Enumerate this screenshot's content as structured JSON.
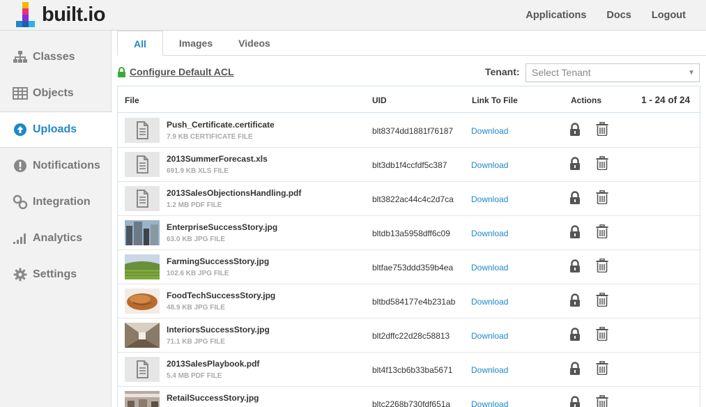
{
  "app": {
    "logo_text": "built.io"
  },
  "topnav": [
    "Applications",
    "Docs",
    "Logout"
  ],
  "sidebar": {
    "items": [
      {
        "label": "Classes",
        "icon": "sitemap-icon",
        "active": false
      },
      {
        "label": "Objects",
        "icon": "table-icon",
        "active": false
      },
      {
        "label": "Uploads",
        "icon": "upload-icon",
        "active": true
      },
      {
        "label": "Notifications",
        "icon": "alert-icon",
        "active": false
      },
      {
        "label": "Integration",
        "icon": "link-icon",
        "active": false
      },
      {
        "label": "Analytics",
        "icon": "bars-icon",
        "active": false
      },
      {
        "label": "Settings",
        "icon": "gear-icon",
        "active": false
      }
    ]
  },
  "tabs": [
    {
      "label": "All",
      "active": true
    },
    {
      "label": "Images",
      "active": false
    },
    {
      "label": "Videos",
      "active": false
    }
  ],
  "acl": {
    "label": "Configure Default ACL"
  },
  "tenant": {
    "label": "Tenant:",
    "placeholder": "Select Tenant"
  },
  "table": {
    "headers": {
      "file": "File",
      "uid": "UID",
      "link": "Link To File",
      "actions": "Actions"
    },
    "pager": {
      "start": "1",
      "end": "24",
      "of": "of",
      "total": "24"
    },
    "rows": [
      {
        "name": "Push_Certificate.certificate",
        "meta": "7.9 KB CERTIFICATE FILE",
        "uid": "blt8374dd1881f76187",
        "link": "Download",
        "thumb": "doc"
      },
      {
        "name": "2013SummerForecast.xls",
        "meta": "691.9 KB XLS FILE",
        "uid": "blt3db1f4ccfdf5c387",
        "link": "Download",
        "thumb": "doc"
      },
      {
        "name": "2013SalesObjectionsHandling.pdf",
        "meta": "1.2 MB PDF FILE",
        "uid": "blt3822ac44c4c2d7ca",
        "link": "Download",
        "thumb": "doc"
      },
      {
        "name": "EnterpriseSuccessStory.jpg",
        "meta": "63.0 KB JPG FILE",
        "uid": "bltdb13a5958dff6c09",
        "link": "Download",
        "thumb": "city"
      },
      {
        "name": "FarmingSuccessStory.jpg",
        "meta": "102.6 KB JPG FILE",
        "uid": "bltfae753ddd359b4ea",
        "link": "Download",
        "thumb": "farm"
      },
      {
        "name": "FoodTechSuccessStory.jpg",
        "meta": "48.9 KB JPG FILE",
        "uid": "bltbd584177e4b231ab",
        "link": "Download",
        "thumb": "bread"
      },
      {
        "name": "InteriorsSuccessStory.jpg",
        "meta": "71.1 KB JPG FILE",
        "uid": "blt2dffc22d28c58813",
        "link": "Download",
        "thumb": "interior"
      },
      {
        "name": "2013SalesPlaybook.pdf",
        "meta": "5.4 MB PDF FILE",
        "uid": "blt4f13cb6b33ba5671",
        "link": "Download",
        "thumb": "doc"
      },
      {
        "name": "RetailSuccessStory.jpg",
        "meta": "",
        "uid": "bltc2268b730fdf651a",
        "link": "Download",
        "thumb": "retail"
      }
    ]
  },
  "colors": {
    "accent": "#1e88c8",
    "acl_lock": "#3aaa35"
  }
}
